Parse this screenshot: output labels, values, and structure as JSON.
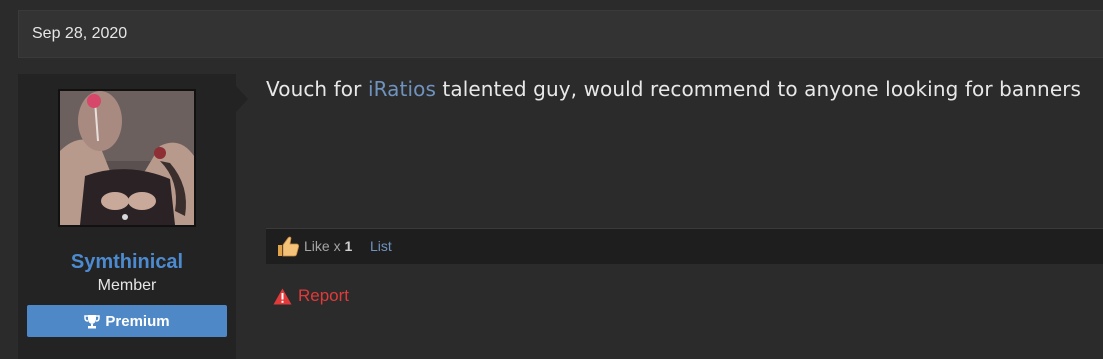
{
  "post": {
    "date": "Sep 28, 2020",
    "message": {
      "prefix": "Vouch for ",
      "mention": "iRatios",
      "suffix": " talented guy, would recommend to anyone looking for banners"
    }
  },
  "user": {
    "name": "Symthinical",
    "title": "Member",
    "badge": "Premium",
    "badge_icon": "trophy-icon"
  },
  "reactions": {
    "like_label": "Like x ",
    "like_count": "1",
    "list_link": "List",
    "icon": "thumbs-up-icon"
  },
  "actions": {
    "report_label": "Report",
    "report_icon": "warning-icon"
  },
  "colors": {
    "username": "#4d8bd1",
    "link": "#6f93be",
    "badge_bg": "#4f88c6",
    "report": "#e03a3a"
  }
}
